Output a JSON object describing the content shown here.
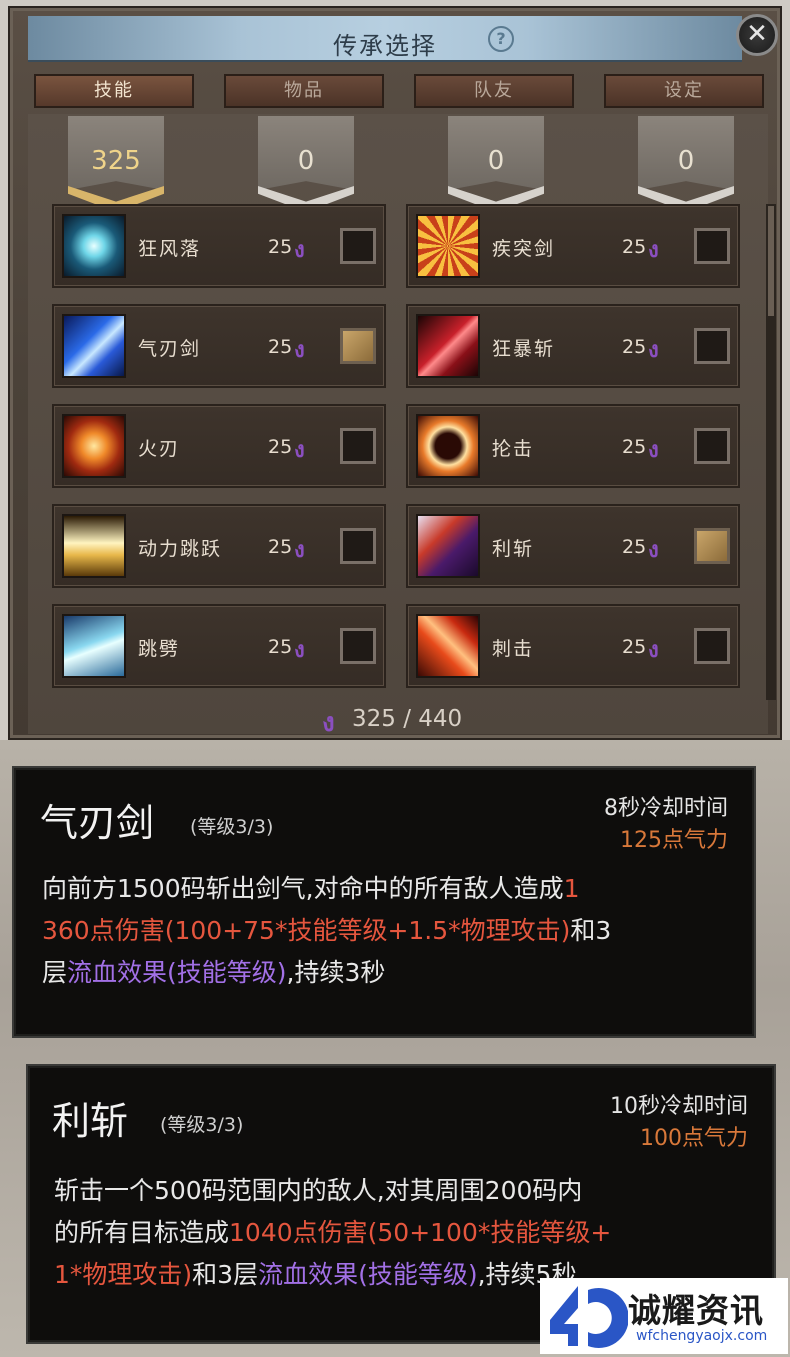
{
  "panel": {
    "title": "传承选择",
    "help_icon": "question-circle-icon",
    "close_icon": "close-icon",
    "tabs": [
      {
        "label": "技能",
        "active": true
      },
      {
        "label": "物品",
        "active": false
      },
      {
        "label": "队友",
        "active": false
      },
      {
        "label": "设定",
        "active": false
      }
    ],
    "tab_points": [
      "325",
      "0",
      "0",
      "0"
    ],
    "skills_left": [
      {
        "name": "狂风落",
        "cost": "25",
        "checked": false,
        "icon": "whirlwind-icon"
      },
      {
        "name": "气刃剑",
        "cost": "25",
        "checked": true,
        "icon": "air-blade-icon"
      },
      {
        "name": "火刃",
        "cost": "25",
        "checked": false,
        "icon": "fire-blade-icon"
      },
      {
        "name": "动力跳跃",
        "cost": "25",
        "checked": false,
        "icon": "power-jump-icon"
      },
      {
        "name": "跳劈",
        "cost": "25",
        "checked": false,
        "icon": "jump-slash-icon"
      }
    ],
    "skills_right": [
      {
        "name": "疾突剑",
        "cost": "25",
        "checked": false,
        "icon": "dash-sword-icon"
      },
      {
        "name": "狂暴斩",
        "cost": "25",
        "checked": false,
        "icon": "berserk-slash-icon"
      },
      {
        "name": "抡击",
        "cost": "25",
        "checked": false,
        "icon": "swing-strike-icon"
      },
      {
        "name": "利斩",
        "cost": "25",
        "checked": true,
        "icon": "sharp-slash-icon"
      },
      {
        "name": "刺击",
        "cost": "25",
        "checked": false,
        "icon": "thrust-icon"
      }
    ],
    "cost_icon": "soul-point-icon",
    "total": "325 / 440"
  },
  "tooltip1": {
    "name": "气刃剑",
    "level": "(等级3/3)",
    "cooldown": "8秒冷却时间",
    "energy": "125点气力",
    "desc_line1_a": "向前方1500码斩出剑气,对命中的所有敌人造成",
    "desc_line1_b": "1",
    "desc_line2_a": "360点伤害(100+75*技能等级+1.5*物理攻击)",
    "desc_line2_b": "和3",
    "desc_line3_a": "层",
    "desc_line3_b": "流血效果(技能等级)",
    "desc_line3_c": ",持续3秒"
  },
  "tooltip2": {
    "name": "利斩",
    "level": "(等级3/3)",
    "cooldown": "10秒冷却时间",
    "energy": "100点气力",
    "desc_line1": "斩击一个500码范围内的敌人,对其周围200码内",
    "desc_line2_a": "的所有目标造成",
    "desc_line2_b": "1040点伤害(50+100*技能等级+",
    "desc_line3_a": "1*物理攻击)",
    "desc_line3_b": "和3层",
    "desc_line3_c": "流血效果(技能等级)",
    "desc_line3_d": ",持续5秒"
  },
  "watermark": {
    "name": "诚耀资讯",
    "url": "wfchengyaojx.com"
  },
  "colors": {
    "title_bar": "#b7cfe0",
    "gold_banner": "#d8b56a",
    "damage_text": "#e5563e",
    "bleed_text": "#a270e6",
    "energy_text": "#d8783a",
    "logo_blue": "#2a56c6"
  }
}
